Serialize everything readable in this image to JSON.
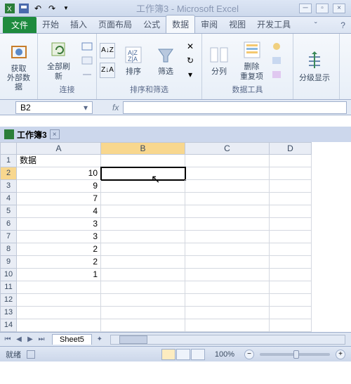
{
  "title_app": "Microsoft Excel",
  "title_doc": "工作簿3",
  "tabs": {
    "file": "文件",
    "home": "开始",
    "insert": "插入",
    "layout": "页面布局",
    "formula": "公式",
    "data": "数据",
    "review": "审阅",
    "view": "视图",
    "dev": "开发工具"
  },
  "ribbon": {
    "ext_data": "获取\n外部数据",
    "refresh": "全部刷新",
    "connections": "连接",
    "sort": "排序",
    "filter": "筛选",
    "sort_filter": "排序和筛选",
    "text_to_cols": "分列",
    "remove_dup": "删除\n重复项",
    "data_tools": "数据工具",
    "outline": "分级显示"
  },
  "namebox": "B2",
  "fx": "fx",
  "workbook_tab": "工作簿3",
  "cols": [
    "A",
    "B",
    "C",
    "D"
  ],
  "rows": [
    1,
    2,
    3,
    4,
    5,
    6,
    7,
    8,
    9,
    10,
    11,
    12,
    13,
    14
  ],
  "cells": {
    "A1": "数据",
    "A2": "10",
    "A3": "9",
    "A4": "7",
    "A5": "4",
    "A6": "3",
    "A7": "3",
    "A8": "2",
    "A9": "2",
    "A10": "1"
  },
  "sheet_tab": "Sheet5",
  "status": "就绪",
  "zoom": "100%"
}
